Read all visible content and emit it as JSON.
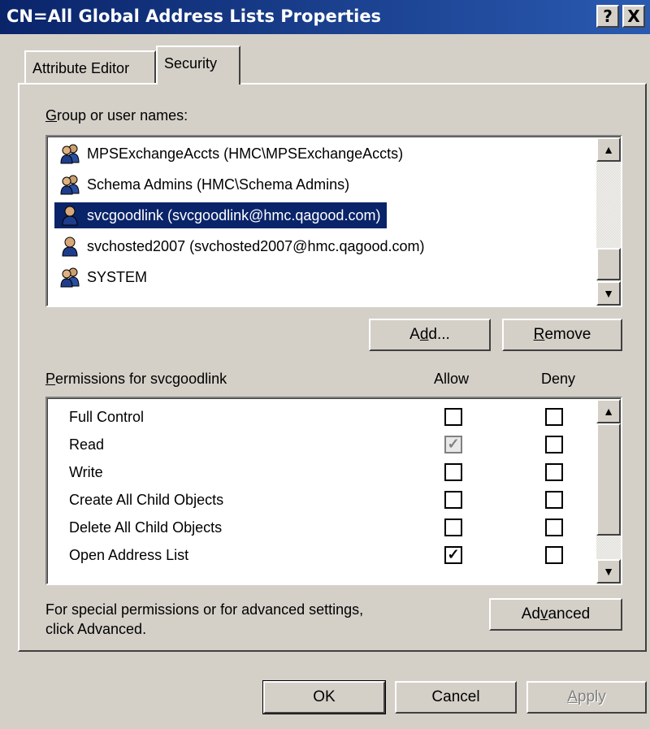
{
  "window": {
    "title": "CN=All Global Address Lists Properties",
    "help_button": "?",
    "close_button": "X"
  },
  "tabs": [
    {
      "label": "Attribute Editor",
      "active": false
    },
    {
      "label": "Security",
      "active": true
    }
  ],
  "group_list": {
    "label_access": "G",
    "label_rest": "roup or user names:",
    "items": [
      {
        "name": "MPSExchangeAccts (HMC\\MPSExchangeAccts)",
        "type": "group",
        "selected": false
      },
      {
        "name": "Schema Admins (HMC\\Schema Admins)",
        "type": "group",
        "selected": false
      },
      {
        "name": "svcgoodlink (svcgoodlink@hmc.qagood.com)",
        "type": "user",
        "selected": true
      },
      {
        "name": "svchosted2007 (svchosted2007@hmc.qagood.com)",
        "type": "user",
        "selected": false
      },
      {
        "name": "SYSTEM",
        "type": "group",
        "selected": false
      }
    ]
  },
  "buttons": {
    "add_pre": "A",
    "add_access": "d",
    "add_post": "d...",
    "remove_access": "R",
    "remove_post": "emove",
    "advanced_pre": "Ad",
    "advanced_access": "v",
    "advanced_post": "anced",
    "ok": "OK",
    "cancel": "Cancel",
    "apply_access": "A",
    "apply_post": "pply"
  },
  "permissions": {
    "label_access": "P",
    "label_rest": "ermissions for svcgoodlink",
    "allow_header": "Allow",
    "deny_header": "Deny",
    "rows": [
      {
        "name": "Full Control",
        "allow": false,
        "allow_inherited": false,
        "deny": false
      },
      {
        "name": "Read",
        "allow": true,
        "allow_inherited": true,
        "deny": false
      },
      {
        "name": "Write",
        "allow": false,
        "allow_inherited": false,
        "deny": false
      },
      {
        "name": "Create All Child Objects",
        "allow": false,
        "allow_inherited": false,
        "deny": false
      },
      {
        "name": "Delete All Child Objects",
        "allow": false,
        "allow_inherited": false,
        "deny": false
      },
      {
        "name": "Open Address List",
        "allow": true,
        "allow_inherited": false,
        "deny": false
      }
    ],
    "check_mark": "✓"
  },
  "advanced_note": {
    "line1": "For special permissions or for advanced settings,",
    "line2": "click Advanced."
  },
  "icons": {
    "group": "group-users-icon",
    "user": "user-icon",
    "scroll_up": "▲",
    "scroll_down": "▼"
  }
}
